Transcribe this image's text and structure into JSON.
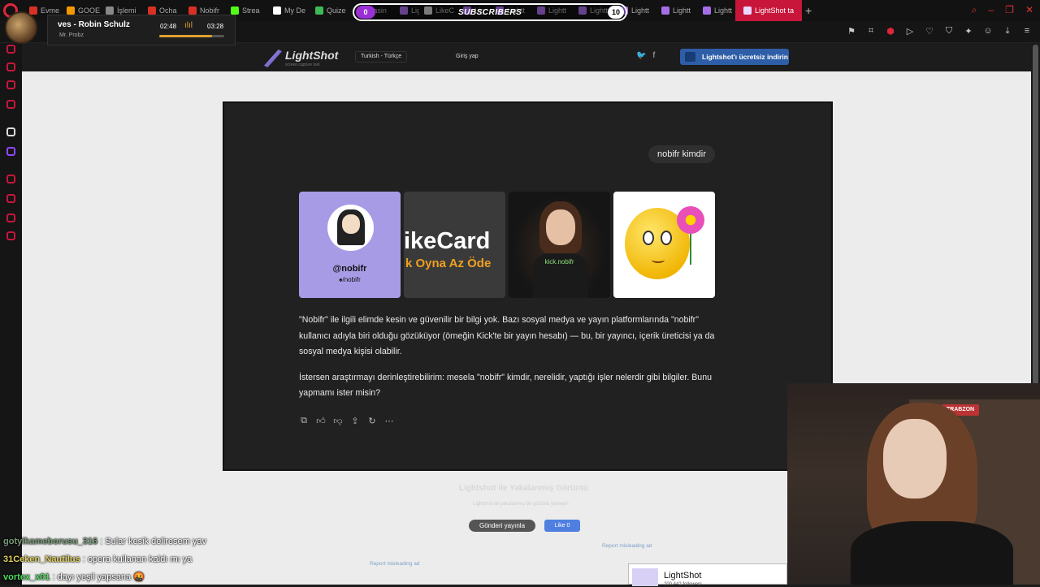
{
  "browser": {
    "tabs": [
      {
        "label": "Evme",
        "color": "#d93025"
      },
      {
        "label": "GOOE",
        "color": "#f29900"
      },
      {
        "label": "İşlemi",
        "color": "#888888"
      },
      {
        "label": "Ocha",
        "color": "#d93025"
      },
      {
        "label": "Nobifr",
        "color": "#d93025"
      },
      {
        "label": "Strea",
        "color": "#53fc18"
      },
      {
        "label": "My De",
        "color": "#ffffff"
      },
      {
        "label": "Quize",
        "color": "#3cba54"
      },
      {
        "label": "Yasin",
        "color": "#3cba54"
      },
      {
        "label": "Lightt",
        "color": "#a56ee8"
      },
      {
        "label": "LikeC",
        "color": "#cccccc"
      },
      {
        "label": "Lig",
        "color": "#a56ee8"
      },
      {
        "label": "Lightt",
        "color": "#a56ee8"
      },
      {
        "label": "Lightt",
        "color": "#a56ee8"
      },
      {
        "label": "Lightt",
        "color": "#a56ee8"
      },
      {
        "label": "Lightt",
        "color": "#a56ee8"
      },
      {
        "label": "Lightt",
        "color": "#a56ee8"
      },
      {
        "label": "Lightt",
        "color": "#a56ee8"
      }
    ],
    "active_tab": "LightShot ta",
    "new_tab": "+",
    "accent": "#c8163a"
  },
  "music": {
    "title": "ves - Robin Schulz",
    "artist": "Mr. Probz",
    "elapsed": "02:48",
    "total": "03:28",
    "progress": 0.81
  },
  "subs_bar": {
    "title": "SUBSCRIBERS",
    "left_badge": "0",
    "right_badge": "10"
  },
  "lightshot": {
    "logo": "LightShot",
    "logo_sub": "screen capture tool",
    "language": "Turkish - Türkçe",
    "login": "Giriş yap",
    "download": "Lightshot'ı ücretsiz indirin",
    "twitter_icon": "twitter-icon",
    "facebook_icon": "facebook-icon"
  },
  "screenshot": {
    "user_message": "nobifr kimdir",
    "images": {
      "card1_handle": "@nobifr",
      "card1_sub": "♠/nobifr",
      "card2_big": "ikeCard",
      "card2_small": "k Oyna Az Öde",
      "card3_label": "kick.nobifr"
    },
    "paragraph1": "\"Nobifr\" ile ilgili elimde kesin ve güvenilir bir bilgi yok. Bazı sosyal medya ve yayın platformlarında \"nobifr\" kullanıcı adıyla biri olduğu gözüküyor (örneğin Kick'te bir yayın hesabı) — bu, bir yayıncı, içerik üreticisi ya da sosyal medya kişisi olabilir.",
    "paragraph2": "İstersen araştırmayı derinleştirebilirim: mesela \"nobifr\" kimdir, nerelidir, yaptığı işler nelerdir gibi bilgiler. Bunu yapmamı ister misin?",
    "action_icons": [
      "copy-icon",
      "thumbs-up-icon",
      "thumbs-down-icon",
      "share-icon",
      "regenerate-icon",
      "more-icon"
    ]
  },
  "below": {
    "title": "Lightshot ile Yakalanmış Görüntü",
    "sub": "Lightshot ile yakalanmış bir görüntü yükleyin",
    "tweet": "Gönderi yayınla",
    "like": "Like 0",
    "report1": "Report misleading ad",
    "report2": "Report misleading ad"
  },
  "notification": {
    "title": "LightShot",
    "sub": "200.442 followers"
  },
  "webcam": {
    "sign": "TRABZON"
  },
  "chat": [
    {
      "user": "gotyikameborusu_316",
      "message": ": Sular kesik deliresem yav",
      "color": "#7a9a7a"
    },
    {
      "user": "31Ceken_Nautilus",
      "message": ": opera kullanan kaldı mı ya",
      "color": "#e0d060"
    },
    {
      "user": "vortex_x01",
      "message": ": dayı yeşil yapsana 🤬",
      "color": "#4fdc5f"
    }
  ]
}
